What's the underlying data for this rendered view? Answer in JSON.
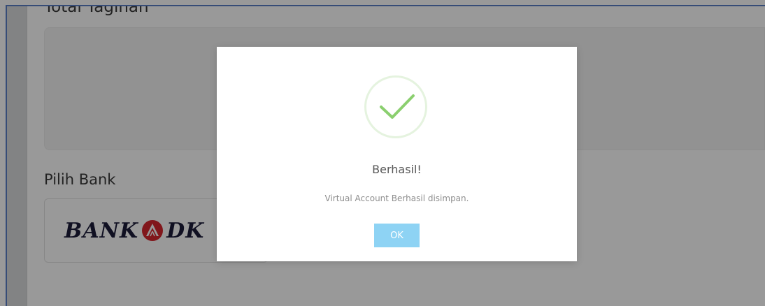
{
  "page": {
    "total_label": "Total Tagihan",
    "bank_label": "Pilih Bank"
  },
  "bank": {
    "name_part1": "BANK",
    "name_part2": "DK",
    "emblem_icon": "dki-emblem-icon",
    "emblem_color": "#d7262d"
  },
  "modal": {
    "title": "Berhasil!",
    "message": "Virtual Account Berhasil disimpan.",
    "ok_label": "OK",
    "status_icon": "check-icon",
    "success_color": "#8bcf6f",
    "button_color": "#8ed3f4"
  }
}
